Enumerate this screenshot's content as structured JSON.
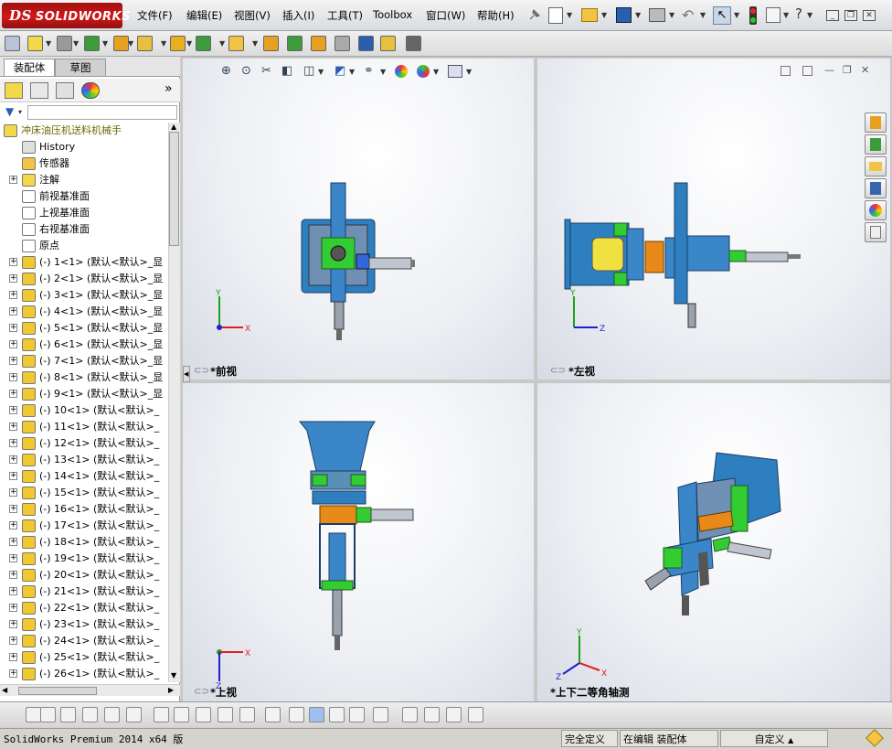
{
  "app": {
    "logo": "SOLIDWORKS",
    "version_text": "SolidWorks Premium 2014 x64 版"
  },
  "menu": [
    {
      "label": "文件(F)"
    },
    {
      "label": "编辑(E)"
    },
    {
      "label": "视图(V)"
    },
    {
      "label": "插入(I)"
    },
    {
      "label": "工具(T)"
    },
    {
      "label": "Toolbox"
    },
    {
      "label": "窗口(W)"
    },
    {
      "label": "帮助(H)"
    }
  ],
  "left_pane": {
    "tabs": [
      {
        "label": "装配体",
        "active": true
      },
      {
        "label": "草图",
        "active": false
      }
    ],
    "tree": {
      "root": "冲床油压机送料机械手",
      "fixed_items": [
        {
          "label": "History",
          "icon": "history-icon",
          "expandable": false
        },
        {
          "label": "传感器",
          "icon": "sensor-icon",
          "expandable": false
        },
        {
          "label": "注解",
          "icon": "annotation-icon",
          "expandable": true
        },
        {
          "label": "前视基准面",
          "icon": "plane-icon",
          "expandable": false
        },
        {
          "label": "上视基准面",
          "icon": "plane-icon",
          "expandable": false
        },
        {
          "label": "右视基准面",
          "icon": "plane-icon",
          "expandable": false
        },
        {
          "label": "原点",
          "icon": "origin-icon",
          "expandable": false
        }
      ],
      "components": [
        {
          "label": "(-) 1<1> (默认<默认>_显"
        },
        {
          "label": "(-) 2<1> (默认<默认>_显"
        },
        {
          "label": "(-) 3<1> (默认<默认>_显"
        },
        {
          "label": "(-) 4<1> (默认<默认>_显"
        },
        {
          "label": "(-) 5<1> (默认<默认>_显"
        },
        {
          "label": "(-) 6<1> (默认<默认>_显"
        },
        {
          "label": "(-) 7<1> (默认<默认>_显"
        },
        {
          "label": "(-) 8<1> (默认<默认>_显"
        },
        {
          "label": "(-) 9<1> (默认<默认>_显"
        },
        {
          "label": "(-) 10<1> (默认<默认>_"
        },
        {
          "label": "(-) 11<1> (默认<默认>_"
        },
        {
          "label": "(-) 12<1> (默认<默认>_"
        },
        {
          "label": "(-) 13<1> (默认<默认>_"
        },
        {
          "label": "(-) 14<1> (默认<默认>_"
        },
        {
          "label": "(-) 15<1> (默认<默认>_"
        },
        {
          "label": "(-) 16<1> (默认<默认>_"
        },
        {
          "label": "(-) 17<1> (默认<默认>_"
        },
        {
          "label": "(-) 18<1> (默认<默认>_"
        },
        {
          "label": "(-) 19<1> (默认<默认>_"
        },
        {
          "label": "(-) 20<1> (默认<默认>_"
        },
        {
          "label": "(-) 21<1> (默认<默认>_"
        },
        {
          "label": "(-) 22<1> (默认<默认>_"
        },
        {
          "label": "(-) 23<1> (默认<默认>_"
        },
        {
          "label": "(-) 24<1> (默认<默认>_"
        },
        {
          "label": "(-) 25<1> (默认<默认>_"
        },
        {
          "label": "(-) 26<1> (默认<默认>_"
        }
      ]
    }
  },
  "viewports": [
    {
      "label": "*前视",
      "axes": [
        "Y",
        "X"
      ]
    },
    {
      "label": "*左视",
      "axes": [
        "Y",
        "Z"
      ]
    },
    {
      "label": "*上视",
      "axes": [
        "X",
        "Z"
      ]
    },
    {
      "label": "*上下二等角轴测",
      "axes": [
        "Y",
        "X",
        "Z"
      ]
    }
  ],
  "status": {
    "left": "SolidWorks Premium 2014 x64 版",
    "defined": "完全定义",
    "editing": "在编辑 装配体",
    "custom": "自定义",
    "custom_arrow": "▲"
  },
  "colors": {
    "logo_red": "#c8161d",
    "part_blue": "#2d7fbf",
    "part_green": "#33cc33",
    "part_orange": "#e88a1a",
    "axis_red": "#e02020",
    "axis_green": "#20a020",
    "axis_blue": "#2020d0"
  }
}
